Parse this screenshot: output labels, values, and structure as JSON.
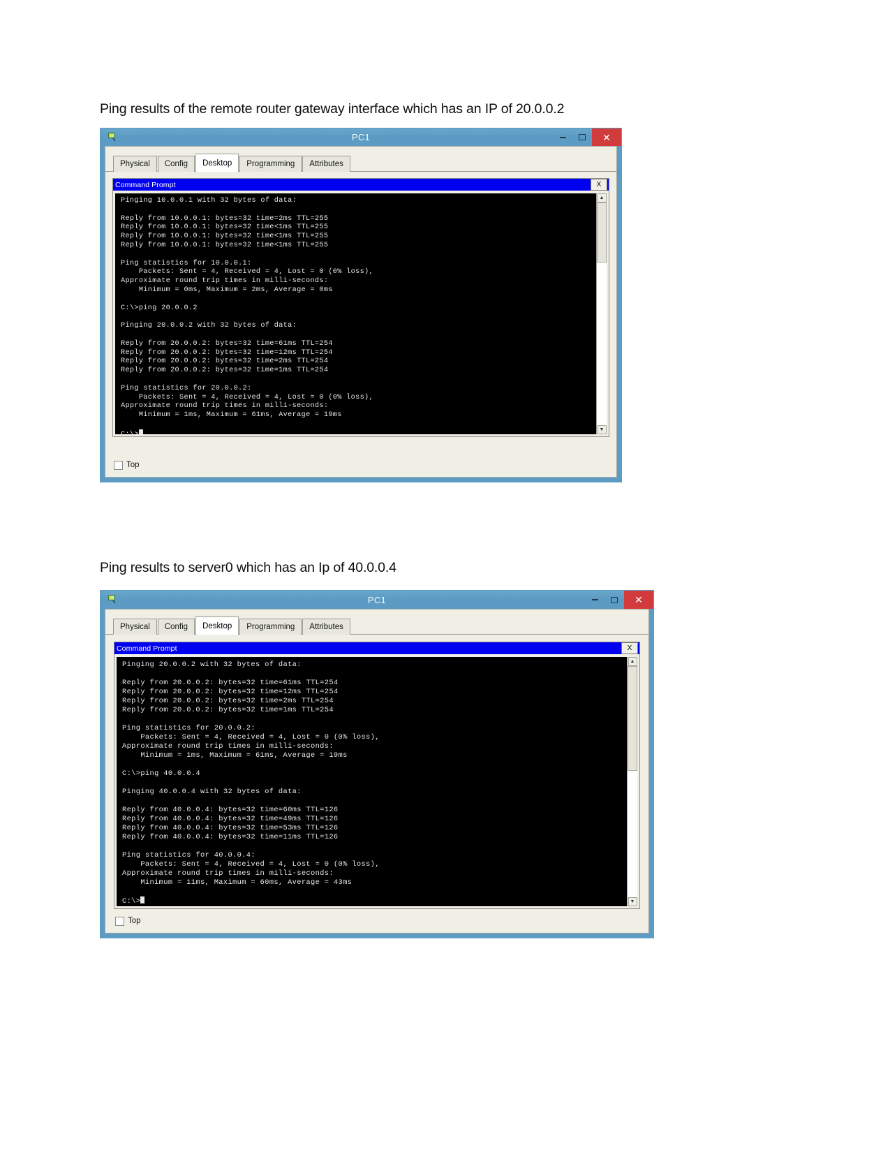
{
  "document": {
    "heading_1": "Ping results of the remote router gateway interface which has an IP of 20.0.0.2",
    "heading_2": "Ping results to server0 which has an Ip of 40.0.0.4"
  },
  "window_1": {
    "title": "PC1",
    "icon": "packet-tracer-pc-icon",
    "controls": {
      "minimize": "–",
      "maximize": "❐",
      "close": "✕"
    },
    "tabs": [
      {
        "label": "Physical",
        "active": false
      },
      {
        "label": "Config",
        "active": false
      },
      {
        "label": "Desktop",
        "active": true
      },
      {
        "label": "Programming",
        "active": false
      },
      {
        "label": "Attributes",
        "active": false
      }
    ],
    "command_prompt": {
      "title": "Command Prompt",
      "close_label": "X"
    },
    "terminal_lines": [
      "Pinging 10.0.0.1 with 32 bytes of data:",
      "",
      "Reply from 10.0.0.1: bytes=32 time=2ms TTL=255",
      "Reply from 10.0.0.1: bytes=32 time<1ms TTL=255",
      "Reply from 10.0.0.1: bytes=32 time<1ms TTL=255",
      "Reply from 10.0.0.1: bytes=32 time<1ms TTL=255",
      "",
      "Ping statistics for 10.0.0.1:",
      "    Packets: Sent = 4, Received = 4, Lost = 0 (0% loss),",
      "Approximate round trip times in milli-seconds:",
      "    Minimum = 0ms, Maximum = 2ms, Average = 0ms",
      "",
      "C:\\>ping 20.0.0.2",
      "",
      "Pinging 20.0.0.2 with 32 bytes of data:",
      "",
      "Reply from 20.0.0.2: bytes=32 time=61ms TTL=254",
      "Reply from 20.0.0.2: bytes=32 time=12ms TTL=254",
      "Reply from 20.0.0.2: bytes=32 time=2ms TTL=254",
      "Reply from 20.0.0.2: bytes=32 time=1ms TTL=254",
      "",
      "Ping statistics for 20.0.0.2:",
      "    Packets: Sent = 4, Received = 4, Lost = 0 (0% loss),",
      "Approximate round trip times in milli-seconds:",
      "    Minimum = 1ms, Maximum = 61ms, Average = 19ms",
      "",
      "C:\\>"
    ],
    "scrollbar": {
      "up_arrow": "▲",
      "down_arrow": "▼"
    },
    "footer": {
      "top_label": "Top",
      "top_checked": false
    }
  },
  "window_2": {
    "title": "PC1",
    "icon": "packet-tracer-pc-icon",
    "controls": {
      "minimize": "–",
      "maximize": "❐",
      "close": "✕"
    },
    "tabs": [
      {
        "label": "Physical",
        "active": false
      },
      {
        "label": "Config",
        "active": false
      },
      {
        "label": "Desktop",
        "active": true
      },
      {
        "label": "Programming",
        "active": false
      },
      {
        "label": "Attributes",
        "active": false
      }
    ],
    "command_prompt": {
      "title": "Command Prompt",
      "close_label": "X"
    },
    "terminal_lines": [
      "Pinging 20.0.0.2 with 32 bytes of data:",
      "",
      "Reply from 20.0.0.2: bytes=32 time=61ms TTL=254",
      "Reply from 20.0.0.2: bytes=32 time=12ms TTL=254",
      "Reply from 20.0.0.2: bytes=32 time=2ms TTL=254",
      "Reply from 20.0.0.2: bytes=32 time=1ms TTL=254",
      "",
      "Ping statistics for 20.0.0.2:",
      "    Packets: Sent = 4, Received = 4, Lost = 0 (0% loss),",
      "Approximate round trip times in milli-seconds:",
      "    Minimum = 1ms, Maximum = 61ms, Average = 19ms",
      "",
      "C:\\>ping 40.0.0.4",
      "",
      "Pinging 40.0.0.4 with 32 bytes of data:",
      "",
      "Reply from 40.0.0.4: bytes=32 time=60ms TTL=126",
      "Reply from 40.0.0.4: bytes=32 time=49ms TTL=126",
      "Reply from 40.0.0.4: bytes=32 time=53ms TTL=126",
      "Reply from 40.0.0.4: bytes=32 time=11ms TTL=126",
      "",
      "Ping statistics for 40.0.0.4:",
      "    Packets: Sent = 4, Received = 4, Lost = 0 (0% loss),",
      "Approximate round trip times in milli-seconds:",
      "    Minimum = 11ms, Maximum = 60ms, Average = 43ms",
      "",
      "C:\\>"
    ],
    "scrollbar": {
      "up_arrow": "▲",
      "down_arrow": "▼"
    },
    "footer": {
      "top_label": "Top",
      "top_checked": false
    }
  },
  "colors": {
    "titlebar": "#5c9bc3",
    "close_button": "#d23b3b",
    "command_prompt_bar": "#0000f0",
    "terminal_bg": "#000000",
    "terminal_fg": "#e8e8e8",
    "window_body": "#efefe6"
  }
}
